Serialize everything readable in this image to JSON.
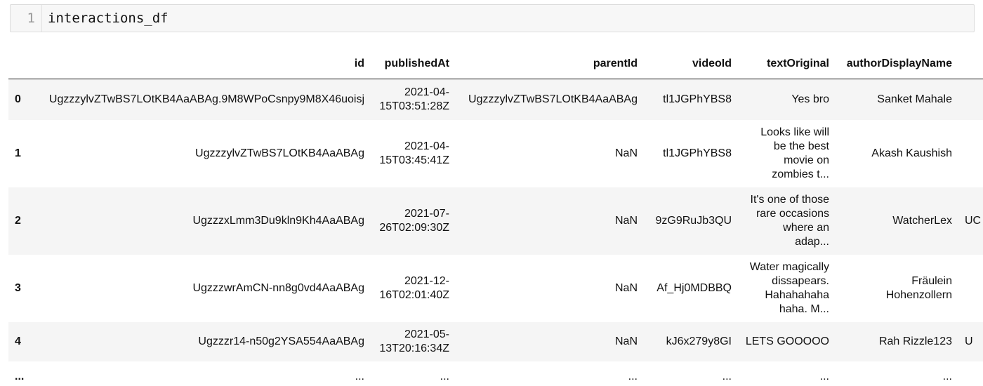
{
  "code_cell": {
    "line_number": "1",
    "code": "interactions_df"
  },
  "table": {
    "columns": [
      "id",
      "publishedAt",
      "parentId",
      "videoId",
      "textOriginal",
      "authorDisplayName",
      ""
    ],
    "rows": [
      {
        "index": "0",
        "id": "UgzzzylvZTwBS7LOtKB4AaABAg.9M8WPoCsnpy9M8X46uoisj",
        "publishedAt": [
          "2021-04-",
          "15T03:51:28Z"
        ],
        "parentId": "UgzzzylvZTwBS7LOtKB4AaABAg",
        "videoId": "tl1JGPhYBS8",
        "textOriginal": [
          "Yes bro"
        ],
        "authorDisplayName": [
          "Sanket Mahale"
        ],
        "extra": ""
      },
      {
        "index": "1",
        "id": "UgzzzylvZTwBS7LOtKB4AaABAg",
        "publishedAt": [
          "2021-04-",
          "15T03:45:41Z"
        ],
        "parentId": "NaN",
        "videoId": "tl1JGPhYBS8",
        "textOriginal": [
          "Looks like will",
          "be the best",
          "movie on",
          "zombies t..."
        ],
        "authorDisplayName": [
          "Akash Kaushish"
        ],
        "extra": ""
      },
      {
        "index": "2",
        "id": "UgzzzxLmm3Du9kln9Kh4AaABAg",
        "publishedAt": [
          "2021-07-",
          "26T02:09:30Z"
        ],
        "parentId": "NaN",
        "videoId": "9zG9RuJb3QU",
        "textOriginal": [
          "It's one of those",
          "rare occasions",
          "where an",
          "adap..."
        ],
        "authorDisplayName": [
          "WatcherLex"
        ],
        "extra": "UC"
      },
      {
        "index": "3",
        "id": "UgzzzwrAmCN-nn8g0vd4AaABAg",
        "publishedAt": [
          "2021-12-",
          "16T02:01:40Z"
        ],
        "parentId": "NaN",
        "videoId": "Af_Hj0MDBBQ",
        "textOriginal": [
          "Water magically",
          "dissapears.",
          "Hahahahaha",
          "haha. M..."
        ],
        "authorDisplayName": [
          "Fräulein",
          "Hohenzollern"
        ],
        "extra": ""
      },
      {
        "index": "4",
        "id": "Ugzzzr14-n50g2YSA554AaABAg",
        "publishedAt": [
          "2021-05-",
          "13T20:16:34Z"
        ],
        "parentId": "NaN",
        "videoId": "kJ6x279y8GI",
        "textOriginal": [
          "LETS GOOOOO"
        ],
        "authorDisplayName": [
          "Rah Rizzle123"
        ],
        "extra": "U"
      }
    ],
    "ellipsis_row": {
      "index": "...",
      "cells": [
        "...",
        "...",
        "...",
        "...",
        "...",
        "...",
        ""
      ]
    }
  }
}
